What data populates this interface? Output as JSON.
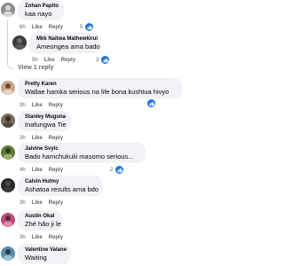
{
  "comments": [
    {
      "name": "Zohan Papito",
      "text": "kaa nayo",
      "time": "6h",
      "like": "Like",
      "reply": "Reply",
      "reaction_count": "5"
    },
    {
      "name": "Mkk Naitwa Mathewkirui",
      "text": "Ameongea ama bado",
      "time": "5h",
      "like": "Like",
      "reply": "Reply",
      "reaction_count": "3"
    },
    {
      "name": "Pretty Karen",
      "text": "Wallae hamka serious na life bona kushtua hivyo",
      "time": "3h",
      "like": "Like",
      "reply": "Reply",
      "reaction_count": ""
    },
    {
      "name": "Stanley Muguna",
      "text": "Inafungwa Tie",
      "time": "3h",
      "like": "Like",
      "reply": "Reply",
      "reaction_count": ""
    },
    {
      "name": "Jaivine Svylc",
      "text": "Bado hamchukulii masomo serious...",
      "time": "4h",
      "like": "Like",
      "reply": "Reply",
      "reaction_count": "2"
    },
    {
      "name": "Calvin Hutmy",
      "text": "Ashatoa results ama bdo",
      "time": "3h",
      "like": "Like",
      "reply": "Reply",
      "reaction_count": ""
    },
    {
      "name": "Austin Okal",
      "text": "Zhé hão ji le",
      "time": "3h",
      "like": "Like",
      "reply": "Reply",
      "reaction_count": ""
    },
    {
      "name": "Valentine Valane",
      "text": "Waiting",
      "time": "3h",
      "like": "Like",
      "reply": "Reply",
      "reaction_count": ""
    }
  ],
  "view_replies": "View 1 reply",
  "icons": {
    "reaction": "like-icon"
  },
  "colors": {
    "bubble": "#f0f2f5",
    "like_blue": "#1b74e4",
    "meta_gray": "#65676b"
  }
}
